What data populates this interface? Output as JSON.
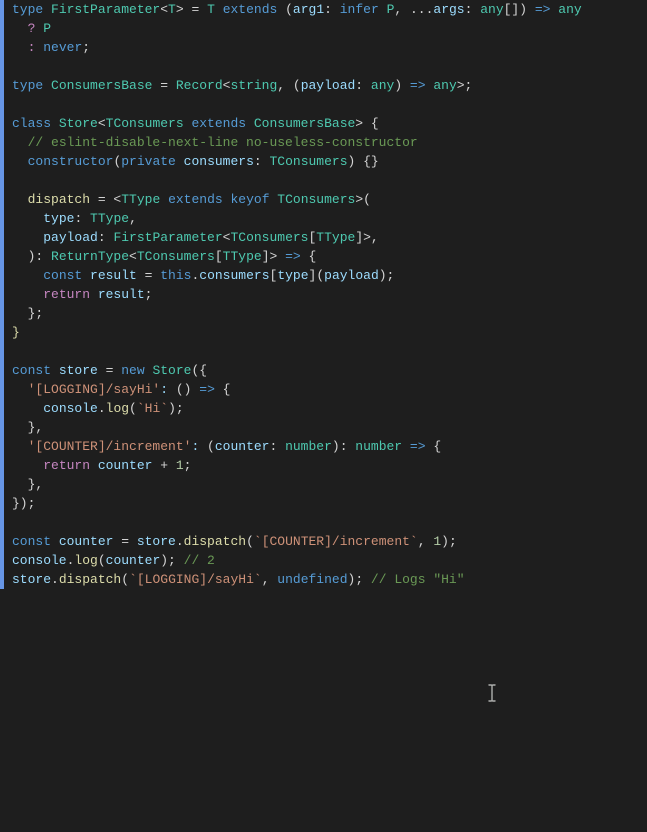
{
  "theme": {
    "background": "#1e1e1e",
    "foreground": "#d4d4d4",
    "keyword": "#569cd6",
    "type": "#4ec9b0",
    "function": "#dcdcaa",
    "variable": "#9cdcfe",
    "string": "#ce9178",
    "number": "#b5cea8",
    "comment": "#6a9955",
    "control": "#c586c0"
  },
  "code": [
    [
      [
        "kw",
        "type "
      ],
      [
        "ty",
        "FirstParameter"
      ],
      [
        "pn",
        "<"
      ],
      [
        "ty",
        "T"
      ],
      [
        "pn",
        "> = "
      ],
      [
        "ty",
        "T"
      ],
      [
        "kw",
        " extends "
      ],
      [
        "pn",
        "("
      ],
      [
        "vr",
        "arg1"
      ],
      [
        "pn",
        ": "
      ],
      [
        "kw",
        "infer "
      ],
      [
        "ty",
        "P"
      ],
      [
        "pn",
        ", ..."
      ],
      [
        "vr",
        "args"
      ],
      [
        "pn",
        ": "
      ],
      [
        "ty",
        "any"
      ],
      [
        "pn",
        "[]) "
      ],
      [
        "ar",
        "=>"
      ],
      [
        "pn",
        " "
      ],
      [
        "ty",
        "any"
      ]
    ],
    [
      [
        "pn",
        "  "
      ],
      [
        "ct",
        "?"
      ],
      [
        "pn",
        " "
      ],
      [
        "ty",
        "P"
      ]
    ],
    [
      [
        "pn",
        "  "
      ],
      [
        "ct",
        ":"
      ],
      [
        "pn",
        " "
      ],
      [
        "kw",
        "never"
      ],
      [
        "pn",
        ";"
      ]
    ],
    [],
    [
      [
        "kw",
        "type "
      ],
      [
        "ty",
        "ConsumersBase"
      ],
      [
        "pn",
        " = "
      ],
      [
        "ty",
        "Record"
      ],
      [
        "pn",
        "<"
      ],
      [
        "ty",
        "string"
      ],
      [
        "pn",
        ", ("
      ],
      [
        "vr",
        "payload"
      ],
      [
        "pn",
        ": "
      ],
      [
        "ty",
        "any"
      ],
      [
        "pn",
        ") "
      ],
      [
        "ar",
        "=>"
      ],
      [
        "pn",
        " "
      ],
      [
        "ty",
        "any"
      ],
      [
        "pn",
        ">;"
      ]
    ],
    [],
    [
      [
        "kw",
        "class "
      ],
      [
        "ty",
        "Store"
      ],
      [
        "pn",
        "<"
      ],
      [
        "ty",
        "TConsumers"
      ],
      [
        "kw",
        " extends "
      ],
      [
        "ty",
        "ConsumersBase"
      ],
      [
        "pn",
        "> {"
      ]
    ],
    [
      [
        "pn",
        "  "
      ],
      [
        "cm",
        "// eslint-disable-next-line no-useless-constructor"
      ]
    ],
    [
      [
        "pn",
        "  "
      ],
      [
        "kw",
        "constructor"
      ],
      [
        "pn",
        "("
      ],
      [
        "kw",
        "private "
      ],
      [
        "vr",
        "consumers"
      ],
      [
        "pn",
        ": "
      ],
      [
        "ty",
        "TConsumers"
      ],
      [
        "pn",
        ") {}"
      ]
    ],
    [],
    [
      [
        "pn",
        "  "
      ],
      [
        "fn",
        "dispatch"
      ],
      [
        "pn",
        " = <"
      ],
      [
        "ty",
        "TType"
      ],
      [
        "kw",
        " extends "
      ],
      [
        "kw",
        "keyof "
      ],
      [
        "ty",
        "TConsumers"
      ],
      [
        "pn",
        ">("
      ]
    ],
    [
      [
        "pn",
        "    "
      ],
      [
        "vr",
        "type"
      ],
      [
        "pn",
        ": "
      ],
      [
        "ty",
        "TType"
      ],
      [
        "pn",
        ","
      ]
    ],
    [
      [
        "pn",
        "    "
      ],
      [
        "vr",
        "payload"
      ],
      [
        "pn",
        ": "
      ],
      [
        "ty",
        "FirstParameter"
      ],
      [
        "pn",
        "<"
      ],
      [
        "ty",
        "TConsumers"
      ],
      [
        "pn",
        "["
      ],
      [
        "ty",
        "TType"
      ],
      [
        "pn",
        "]>,"
      ]
    ],
    [
      [
        "pn",
        "  ): "
      ],
      [
        "ty",
        "ReturnType"
      ],
      [
        "pn",
        "<"
      ],
      [
        "ty",
        "TConsumers"
      ],
      [
        "pn",
        "["
      ],
      [
        "ty",
        "TType"
      ],
      [
        "pn",
        "]> "
      ],
      [
        "ar",
        "=>"
      ],
      [
        "pn",
        " {"
      ]
    ],
    [
      [
        "pn",
        "    "
      ],
      [
        "kw",
        "const "
      ],
      [
        "vr",
        "result"
      ],
      [
        "pn",
        " = "
      ],
      [
        "kw",
        "this"
      ],
      [
        "pn",
        "."
      ],
      [
        "vr",
        "consumers"
      ],
      [
        "pn",
        "["
      ],
      [
        "vr",
        "type"
      ],
      [
        "pn",
        "]("
      ],
      [
        "vr",
        "payload"
      ],
      [
        "pn",
        ");"
      ]
    ],
    [
      [
        "pn",
        "    "
      ],
      [
        "ct",
        "return "
      ],
      [
        "vr",
        "result"
      ],
      [
        "pn",
        ";"
      ]
    ],
    [
      [
        "pn",
        "  };"
      ]
    ],
    [
      [
        "fn",
        "}"
      ]
    ],
    [],
    [
      [
        "kw",
        "const "
      ],
      [
        "vr",
        "store"
      ],
      [
        "pn",
        " = "
      ],
      [
        "kw",
        "new "
      ],
      [
        "ty",
        "Store"
      ],
      [
        "pn",
        "({"
      ]
    ],
    [
      [
        "pn",
        "  "
      ],
      [
        "st",
        "'[LOGGING]/sayHi'"
      ],
      [
        "vr",
        ":"
      ],
      [
        "pn",
        " () "
      ],
      [
        "ar",
        "=>"
      ],
      [
        "pn",
        " {"
      ]
    ],
    [
      [
        "pn",
        "    "
      ],
      [
        "vr",
        "console"
      ],
      [
        "pn",
        "."
      ],
      [
        "fn",
        "log"
      ],
      [
        "pn",
        "("
      ],
      [
        "st",
        "`Hi`"
      ],
      [
        "pn",
        ");"
      ]
    ],
    [
      [
        "pn",
        "  },"
      ]
    ],
    [
      [
        "pn",
        "  "
      ],
      [
        "st",
        "'[COUNTER]/increment'"
      ],
      [
        "vr",
        ":"
      ],
      [
        "pn",
        " ("
      ],
      [
        "vr",
        "counter"
      ],
      [
        "pn",
        ": "
      ],
      [
        "ty",
        "number"
      ],
      [
        "pn",
        "): "
      ],
      [
        "ty",
        "number"
      ],
      [
        "pn",
        " "
      ],
      [
        "ar",
        "=>"
      ],
      [
        "pn",
        " {"
      ]
    ],
    [
      [
        "pn",
        "    "
      ],
      [
        "ct",
        "return "
      ],
      [
        "vr",
        "counter"
      ],
      [
        "pn",
        " + "
      ],
      [
        "nm",
        "1"
      ],
      [
        "pn",
        ";"
      ]
    ],
    [
      [
        "pn",
        "  },"
      ]
    ],
    [
      [
        "pn",
        "});"
      ]
    ],
    [],
    [
      [
        "kw",
        "const "
      ],
      [
        "vr",
        "counter"
      ],
      [
        "pn",
        " = "
      ],
      [
        "vr",
        "store"
      ],
      [
        "pn",
        "."
      ],
      [
        "fn",
        "dispatch"
      ],
      [
        "pn",
        "("
      ],
      [
        "st",
        "`[COUNTER]/increment`"
      ],
      [
        "pn",
        ", "
      ],
      [
        "nm",
        "1"
      ],
      [
        "pn",
        ");"
      ]
    ],
    [
      [
        "vr",
        "console"
      ],
      [
        "pn",
        "."
      ],
      [
        "fn",
        "log"
      ],
      [
        "pn",
        "("
      ],
      [
        "vr",
        "counter"
      ],
      [
        "pn",
        "); "
      ],
      [
        "cm",
        "// 2"
      ]
    ],
    [
      [
        "vr",
        "store"
      ],
      [
        "pn",
        "."
      ],
      [
        "fn",
        "dispatch"
      ],
      [
        "pn",
        "("
      ],
      [
        "st",
        "`[LOGGING]/sayHi`"
      ],
      [
        "pn",
        ", "
      ],
      [
        "kw",
        "undefined"
      ],
      [
        "pn",
        "); "
      ],
      [
        "cm",
        "// Logs \"Hi\""
      ]
    ]
  ],
  "cursor": {
    "line": 36,
    "column": 60,
    "kind": "text-caret"
  }
}
